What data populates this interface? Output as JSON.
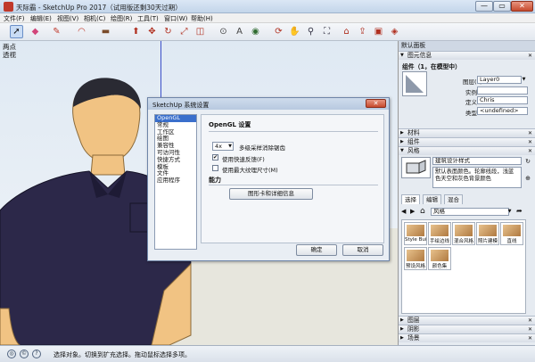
{
  "window": {
    "title": "天际霸 - SketchUp Pro 2017（试用版还剩30天过期）",
    "min": "—",
    "max": "▭",
    "close": "✕"
  },
  "menu": [
    "文件(F)",
    "编辑(E)",
    "视图(V)",
    "相机(C)",
    "绘图(R)",
    "工具(T)",
    "窗口(W)",
    "帮助(H)"
  ],
  "viewport": {
    "label_line1": "两点",
    "label_line2": "透视"
  },
  "dialog": {
    "title": "SketchUp 系统设置",
    "close": "✕",
    "categories": [
      "OpenGL",
      "常规",
      "工作区",
      "绘图",
      "兼容性",
      "可访问性",
      "快捷方式",
      "模板",
      "文件",
      "应用程序"
    ],
    "active_category": "OpenGL",
    "section_opengl": "OpenGL 设置",
    "antialias_value": "4x",
    "antialias_label": "多级采样消除锯齿",
    "fast_feedback_label": "使用快速反馈(F)",
    "fast_feedback_checked": "✔",
    "max_texture_label": "使用最大纹理尺寸(M)",
    "section_capability": "能力",
    "graphics_button": "图形卡和详细信息",
    "ok": "确定",
    "cancel": "取消"
  },
  "panel": {
    "header": "默认面板",
    "entity_info": "图元信息",
    "entity_subtitle": "组件（1，在模型中）",
    "layer_label": "图层(L):",
    "layer_value": "Layer0",
    "instance_label": "实例:",
    "instance_value": "",
    "definition_label": "定义:",
    "definition_value": "Chris",
    "type_label": "类型:",
    "type_value": "<undefined>",
    "materials": "材料",
    "components": "组件",
    "styles": "风格",
    "style_name": "建筑设计样式",
    "style_desc": "默认表面颜色。轮廓线段，浅蓝色天空和灰色背景颜色",
    "tab_select": "选择",
    "tab_edit": "编辑",
    "tab_mix": "混合",
    "style_folder": "风格",
    "tiles": [
      "Style Bui",
      "手绘边线",
      "混合风格",
      "照片建模",
      "直线",
      "预设风格",
      "颜色集"
    ],
    "layers": "图层",
    "shadows": "阴影",
    "scenes": "场景"
  },
  "status": {
    "text": "选择对象。切换到扩充选择。拖动鼠标选择多项。"
  },
  "colors": {
    "accent": "#3a6fcc",
    "shirt": "#2c2849",
    "skin": "#f1c383",
    "axis_blue": "#3b4fc8"
  }
}
